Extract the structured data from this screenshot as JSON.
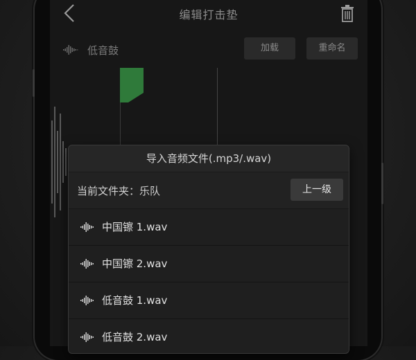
{
  "header": {
    "title": "编辑打击垫",
    "back_icon": "chevron-left-icon",
    "trash_icon": "trash-icon"
  },
  "track": {
    "name": "低音鼓",
    "icon": "waveform-icon",
    "load_label": "加载",
    "rename_label": "重命名"
  },
  "marker": {
    "color": "#2f7a3a"
  },
  "dialog": {
    "title": "导入音频文件(.mp3/.wav)",
    "current_folder_label": "当前文件夹：",
    "current_folder_value": "乐队",
    "up_label": "上一级",
    "files": [
      {
        "name": "中国镲 1.wav",
        "icon": "waveform-icon"
      },
      {
        "name": "中国镲 2.wav",
        "icon": "waveform-icon"
      },
      {
        "name": "低音鼓 1.wav",
        "icon": "waveform-icon"
      },
      {
        "name": "低音鼓 2.wav",
        "icon": "waveform-icon"
      }
    ]
  }
}
